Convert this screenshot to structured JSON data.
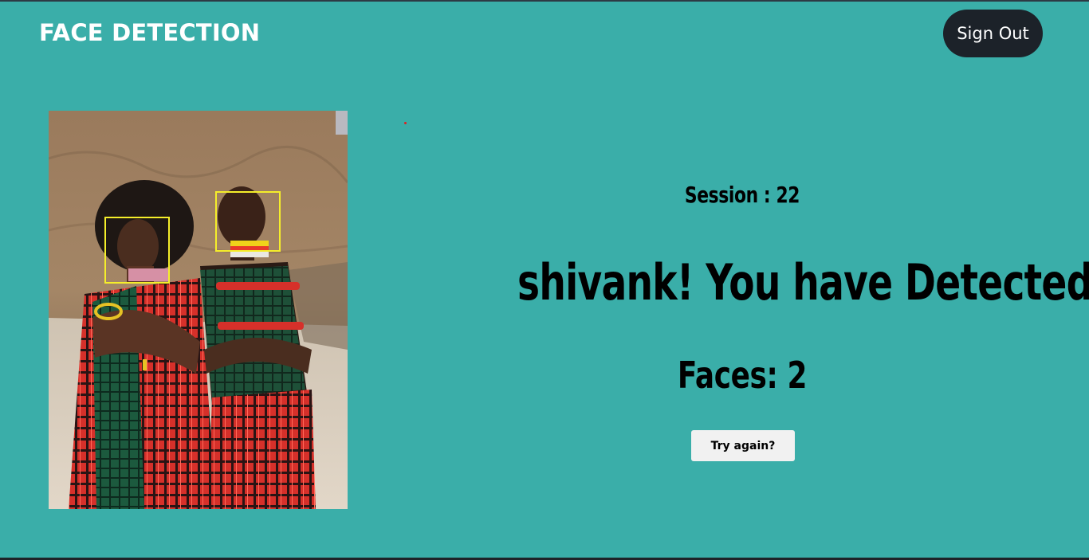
{
  "header": {
    "title": "FACE DETECTION",
    "sign_out_label": "Sign Out"
  },
  "result": {
    "session_text": "Session : 22",
    "headline": "shivank! You have Detected",
    "faces_text": "Faces: 2",
    "try_again_label": "Try again?"
  },
  "image": {
    "detected_faces_count": 2
  },
  "colors": {
    "background": "#3aaea9",
    "sign_out_bg": "#1c2229",
    "face_box": "#f5ee2a"
  }
}
